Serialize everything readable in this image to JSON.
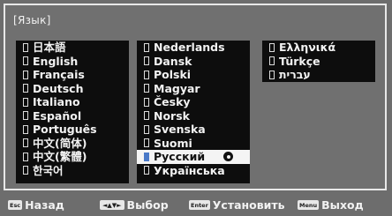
{
  "title": "[Язык]",
  "languages": {
    "col1": [
      "日本語",
      "English",
      "Français",
      "Deutsch",
      "Italiano",
      "Español",
      "Português",
      "中文(简体)",
      "中文(繁體)",
      "한국어"
    ],
    "col2": [
      "Nederlands",
      "Dansk",
      "Polski",
      "Magyar",
      "Česky",
      "Norsk",
      "Svenska",
      "Suomi",
      "Русский",
      "Українська"
    ],
    "col3": [
      "Ελληνικά",
      "Türkçe",
      "עברית"
    ],
    "selected": "Русский"
  },
  "footer": {
    "back_key": "Esc",
    "back_label": "Назад",
    "select_key": "◄▲▼►",
    "select_label": "Выбор",
    "set_key": "Enter",
    "set_label": "Установить",
    "exit_key": "Menu",
    "exit_label": "Выход"
  }
}
